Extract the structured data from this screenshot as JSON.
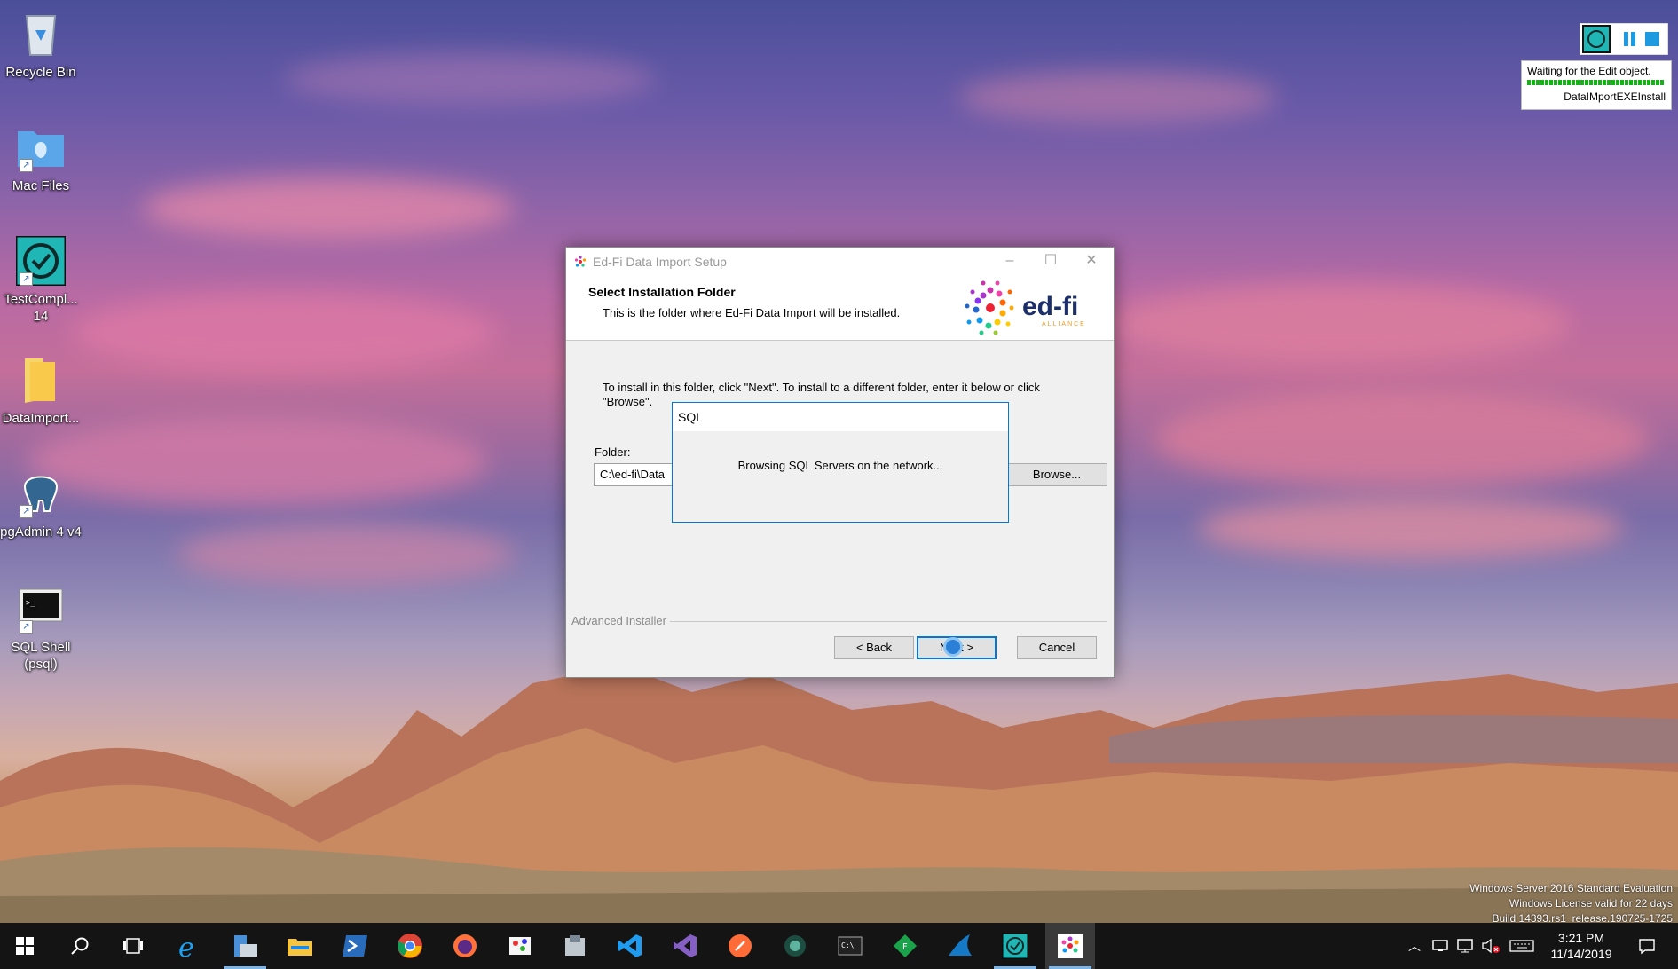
{
  "desktop": {
    "icons": [
      {
        "label": "Recycle Bin",
        "icon": "recycle-bin-icon"
      },
      {
        "label": "Mac Files",
        "icon": "folder-icon"
      },
      {
        "label": "TestCompl... 14",
        "icon": "testcomplete-icon"
      },
      {
        "label": "DataImport...",
        "icon": "folder-icon"
      },
      {
        "label": "pgAdmin 4 v4",
        "icon": "pgadmin-icon"
      },
      {
        "label": "SQL Shell (psql)",
        "icon": "terminal-icon"
      }
    ]
  },
  "setup_window": {
    "title": "Ed-Fi Data Import Setup",
    "header_title": "Select Installation Folder",
    "header_subtitle": "This is the folder where Ed-Fi Data Import will be installed.",
    "logo_text": "ed-fi",
    "logo_subtext": "ALLIANCE",
    "instructions": "To install in this folder, click \"Next\". To install to a different folder, enter it below or click \"Browse\".",
    "folder_label": "Folder:",
    "folder_value": "C:\\ed-fi\\Data",
    "browse_label": "Browse...",
    "advanced_installer": "Advanced Installer",
    "back_label": "< Back",
    "next_label": "Next >",
    "cancel_label": "Cancel"
  },
  "popup": {
    "title": "SQL",
    "message": "Browsing SQL Servers on the network..."
  },
  "testcomplete_widget": {
    "status": "Waiting for the Edit object.",
    "test_name": "DataIMportEXEInstall"
  },
  "watermark": {
    "line1": "Windows Server 2016 Standard Evaluation",
    "line2": "Windows License valid for 22 days",
    "line3": "Build 14393.rs1_release.190725-1725"
  },
  "taskbar": {
    "apps": [
      "internet-explorer-icon",
      "server-manager-icon",
      "file-explorer-icon",
      "powershell-icon",
      "chrome-icon",
      "firefox-icon",
      "paint-icon",
      "winstore-icon",
      "vscode-icon",
      "visual-studio-icon",
      "postman-icon",
      "edge-dev-icon",
      "cmd-icon",
      "green-app-icon",
      "wireshark-icon",
      "testcomplete-icon",
      "edfi-installer-icon"
    ],
    "time": "3:21 PM",
    "date": "11/14/2019"
  },
  "colors": {
    "accent": "#0078d7",
    "taskbar": "#141414",
    "progress": "#16b116"
  }
}
